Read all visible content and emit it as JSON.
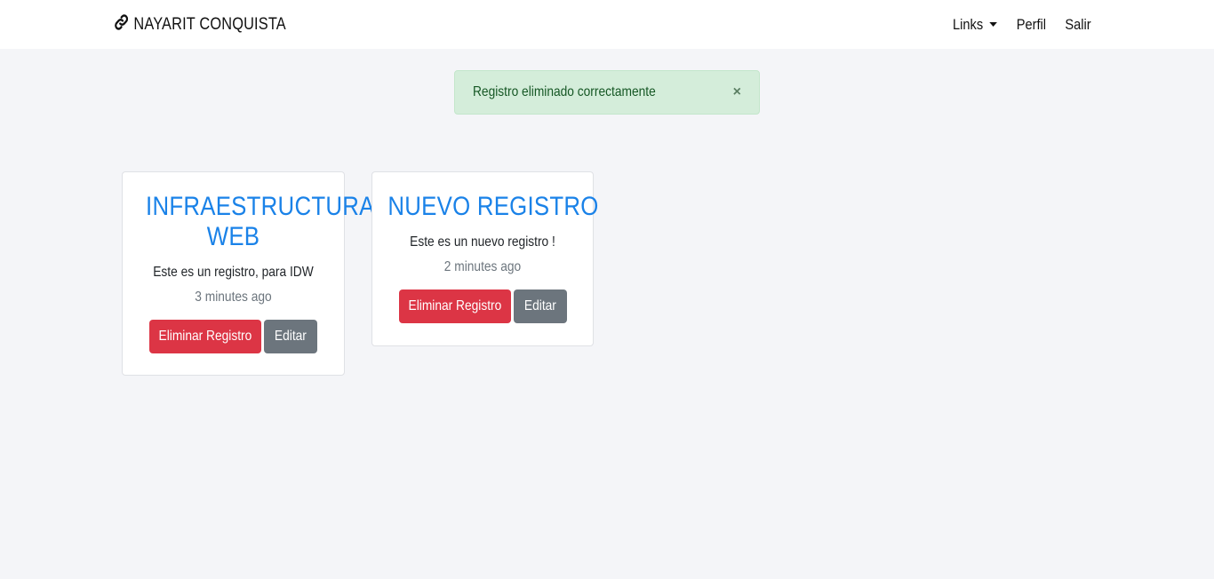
{
  "navbar": {
    "brand": "NAYARIT CONQUISTA",
    "brand_icon": "link-icon",
    "links": [
      {
        "label": "Links",
        "dropdown": true
      },
      {
        "label": "Perfil"
      },
      {
        "label": "Salir"
      }
    ]
  },
  "alert": {
    "message": "Registro eliminado correctamente",
    "close": "×",
    "color": "#d4edda"
  },
  "cards": [
    {
      "title": "INFRAESTRUCTURA WEB",
      "description": "Este es un registro, para IDW",
      "time": "3 minutes ago",
      "delete_label": "Eliminar Registro",
      "edit_label": "Editar"
    },
    {
      "title": "NUEVO REGISTRO",
      "description": "Este es un nuevo registro !",
      "time": "2 minutes ago",
      "delete_label": "Eliminar Registro",
      "edit_label": "Editar"
    }
  ],
  "colors": {
    "accent": "#1a82e8",
    "danger": "#dc3545",
    "secondary": "#6c757d",
    "background": "#f4f5f8"
  }
}
